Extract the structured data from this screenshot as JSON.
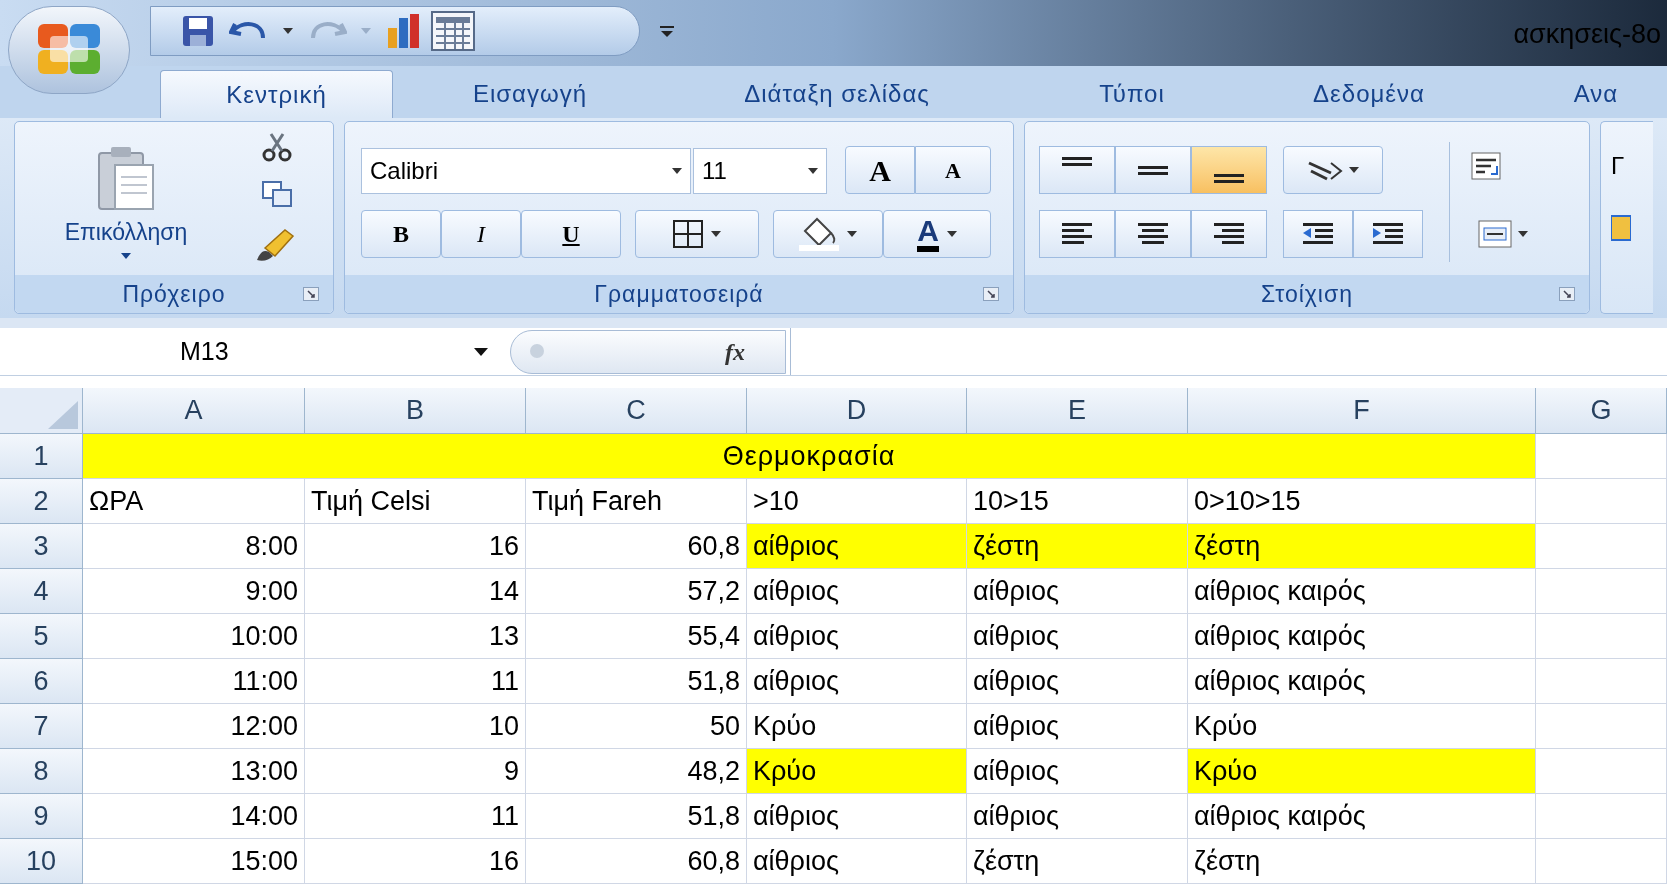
{
  "window": {
    "title": "ασκησεις-8ο"
  },
  "tabs": [
    {
      "label": "Κεντρική",
      "selected": true
    },
    {
      "label": "Εισαγωγή",
      "selected": false
    },
    {
      "label": "Διάταξη σελίδας",
      "selected": false
    },
    {
      "label": "Τύποι",
      "selected": false
    },
    {
      "label": "Δεδομένα",
      "selected": false
    },
    {
      "label": "Ανα",
      "selected": false
    }
  ],
  "ribbon": {
    "paste_label": "Επικόλληση",
    "font_name": "Calibri",
    "font_size": "11",
    "bold_label": "B",
    "italic_label": "I",
    "underline_label": "U",
    "grow_label": "A",
    "shrink_label": "A",
    "font_color_label": "A",
    "partial_group_label": "Γ",
    "groups": [
      {
        "title": "Πρόχειρο"
      },
      {
        "title": "Γραμματοσειρά"
      },
      {
        "title": "Στοίχιση"
      }
    ],
    "vertical_align": [
      {
        "selected": false
      },
      {
        "selected": false
      },
      {
        "selected": true
      }
    ]
  },
  "formula_bar": {
    "name_box": "M13",
    "fx": "fx"
  },
  "sheet": {
    "columns": [
      "A",
      "B",
      "C",
      "D",
      "E",
      "F",
      "G"
    ],
    "rows": [
      {
        "header": "1",
        "title": {
          "text": "Θερμοκρασία",
          "highlighted": true
        }
      },
      {
        "header": "2",
        "cells": [
          {
            "kind": "text",
            "text": "ΩΡΑ",
            "highlighted": false
          },
          {
            "kind": "text",
            "text": "Τιμή Celsi",
            "highlighted": false
          },
          {
            "kind": "text",
            "text": "Τιμή Fareh",
            "highlighted": false
          },
          {
            "kind": "text",
            "text": ">10",
            "highlighted": false
          },
          {
            "kind": "text",
            "text": "10>15",
            "highlighted": false
          },
          {
            "kind": "text",
            "text": "0>10>15",
            "highlighted": false
          }
        ]
      },
      {
        "header": "3",
        "cells": [
          {
            "kind": "number",
            "text": "8:00",
            "highlighted": false
          },
          {
            "kind": "number",
            "text": "16",
            "highlighted": false
          },
          {
            "kind": "number",
            "text": "60,8",
            "highlighted": false
          },
          {
            "kind": "text",
            "text": "αίθριος",
            "highlighted": true
          },
          {
            "kind": "text",
            "text": "ζέστη",
            "highlighted": true
          },
          {
            "kind": "text",
            "text": "ζέστη",
            "highlighted": true
          }
        ]
      },
      {
        "header": "4",
        "cells": [
          {
            "kind": "number",
            "text": "9:00",
            "highlighted": false
          },
          {
            "kind": "number",
            "text": "14",
            "highlighted": false
          },
          {
            "kind": "number",
            "text": "57,2",
            "highlighted": false
          },
          {
            "kind": "text",
            "text": "αίθριος",
            "highlighted": false
          },
          {
            "kind": "text",
            "text": "αίθριος",
            "highlighted": false
          },
          {
            "kind": "text",
            "text": "αίθριος καιρός",
            "highlighted": false
          }
        ]
      },
      {
        "header": "5",
        "cells": [
          {
            "kind": "number",
            "text": "10:00",
            "highlighted": false
          },
          {
            "kind": "number",
            "text": "13",
            "highlighted": false
          },
          {
            "kind": "number",
            "text": "55,4",
            "highlighted": false
          },
          {
            "kind": "text",
            "text": "αίθριος",
            "highlighted": false
          },
          {
            "kind": "text",
            "text": "αίθριος",
            "highlighted": false
          },
          {
            "kind": "text",
            "text": "αίθριος καιρός",
            "highlighted": false
          }
        ]
      },
      {
        "header": "6",
        "cells": [
          {
            "kind": "number",
            "text": "11:00",
            "highlighted": false
          },
          {
            "kind": "number",
            "text": "11",
            "highlighted": false
          },
          {
            "kind": "number",
            "text": "51,8",
            "highlighted": false
          },
          {
            "kind": "text",
            "text": "αίθριος",
            "highlighted": false
          },
          {
            "kind": "text",
            "text": "αίθριος",
            "highlighted": false
          },
          {
            "kind": "text",
            "text": "αίθριος καιρός",
            "highlighted": false
          }
        ]
      },
      {
        "header": "7",
        "cells": [
          {
            "kind": "number",
            "text": "12:00",
            "highlighted": false
          },
          {
            "kind": "number",
            "text": "10",
            "highlighted": false
          },
          {
            "kind": "number",
            "text": "50",
            "highlighted": false
          },
          {
            "kind": "text",
            "text": "Κρύο",
            "highlighted": false
          },
          {
            "kind": "text",
            "text": "αίθριος",
            "highlighted": false
          },
          {
            "kind": "text",
            "text": "Κρύο",
            "highlighted": false
          }
        ]
      },
      {
        "header": "8",
        "cells": [
          {
            "kind": "number",
            "text": "13:00",
            "highlighted": false
          },
          {
            "kind": "number",
            "text": "9",
            "highlighted": false
          },
          {
            "kind": "number",
            "text": "48,2",
            "highlighted": false
          },
          {
            "kind": "text",
            "text": "Κρύο",
            "highlighted": true
          },
          {
            "kind": "text",
            "text": "αίθριος",
            "highlighted": false
          },
          {
            "kind": "text",
            "text": "Κρύο",
            "highlighted": true
          }
        ]
      },
      {
        "header": "9",
        "cells": [
          {
            "kind": "number",
            "text": "14:00",
            "highlighted": false
          },
          {
            "kind": "number",
            "text": "11",
            "highlighted": false
          },
          {
            "kind": "number",
            "text": "51,8",
            "highlighted": false
          },
          {
            "kind": "text",
            "text": "αίθριος",
            "highlighted": false
          },
          {
            "kind": "text",
            "text": "αίθριος",
            "highlighted": false
          },
          {
            "kind": "text",
            "text": "αίθριος καιρός",
            "highlighted": false
          }
        ]
      },
      {
        "header": "10",
        "cells": [
          {
            "kind": "number",
            "text": "15:00",
            "highlighted": false
          },
          {
            "kind": "number",
            "text": "16",
            "highlighted": false
          },
          {
            "kind": "number",
            "text": "60,8",
            "highlighted": false
          },
          {
            "kind": "text",
            "text": "αίθριος",
            "highlighted": false
          },
          {
            "kind": "text",
            "text": "ζέστη",
            "highlighted": false
          },
          {
            "kind": "text",
            "text": "ζέστη",
            "highlighted": false
          }
        ]
      }
    ]
  }
}
